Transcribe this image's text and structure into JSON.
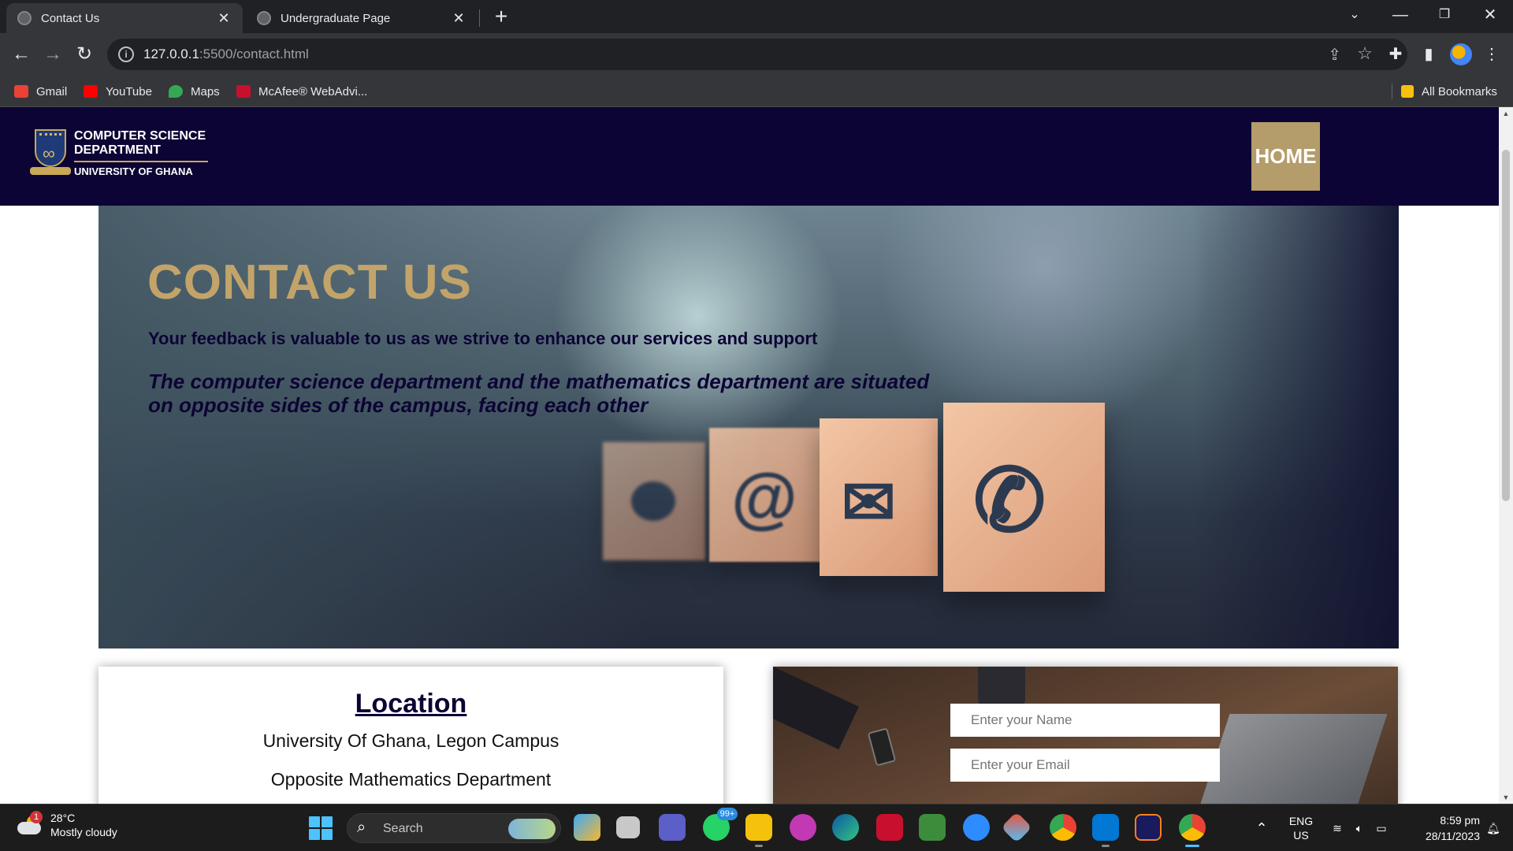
{
  "browser": {
    "tabs": [
      {
        "label": "Contact Us",
        "active": true
      },
      {
        "label": "Undergraduate Page",
        "active": false
      }
    ],
    "url_host": "127.0.0.1",
    "url_path": ":5500/contact.html",
    "bookmarks": [
      {
        "label": "Gmail",
        "icon": "gmail-icon",
        "color": "#ea4335"
      },
      {
        "label": "YouTube",
        "icon": "youtube-icon",
        "color": "#ff0000"
      },
      {
        "label": "Maps",
        "icon": "maps-icon",
        "color": "#34a853"
      },
      {
        "label": "McAfee® WebAdvi...",
        "icon": "mcafee-icon",
        "color": "#c8102e"
      }
    ],
    "all_bookmarks": "All Bookmarks"
  },
  "site": {
    "logo": {
      "line1": "COMPUTER SCIENCE",
      "line2": "DEPARTMENT",
      "line3": "UNIVERSITY OF GHANA"
    },
    "nav_home": "HOME",
    "colors": {
      "navy": "#0c0434",
      "gold": "#b49c6b",
      "title_gold": "#c2a46a"
    }
  },
  "hero": {
    "title": "CONTACT US",
    "subtitle": "Your feedback is valuable to us as we strive to enhance our services and support",
    "description": "The computer science department and the mathematics department are situated on opposite sides of the campus, facing each other"
  },
  "location": {
    "heading": "Location",
    "line1": "University Of Ghana, Legon Campus",
    "line2": "Opposite Mathematics Department"
  },
  "form": {
    "name_placeholder": "Enter your Name",
    "email_placeholder": "Enter your Email"
  },
  "taskbar": {
    "weather_temp": "28°C",
    "weather_desc": "Mostly cloudy",
    "weather_badge": "1",
    "search_label": "Search",
    "whatsapp_badge": "99+",
    "lang_top": "ENG",
    "lang_bottom": "US",
    "time": "8:59 pm",
    "date": "28/11/2023"
  }
}
